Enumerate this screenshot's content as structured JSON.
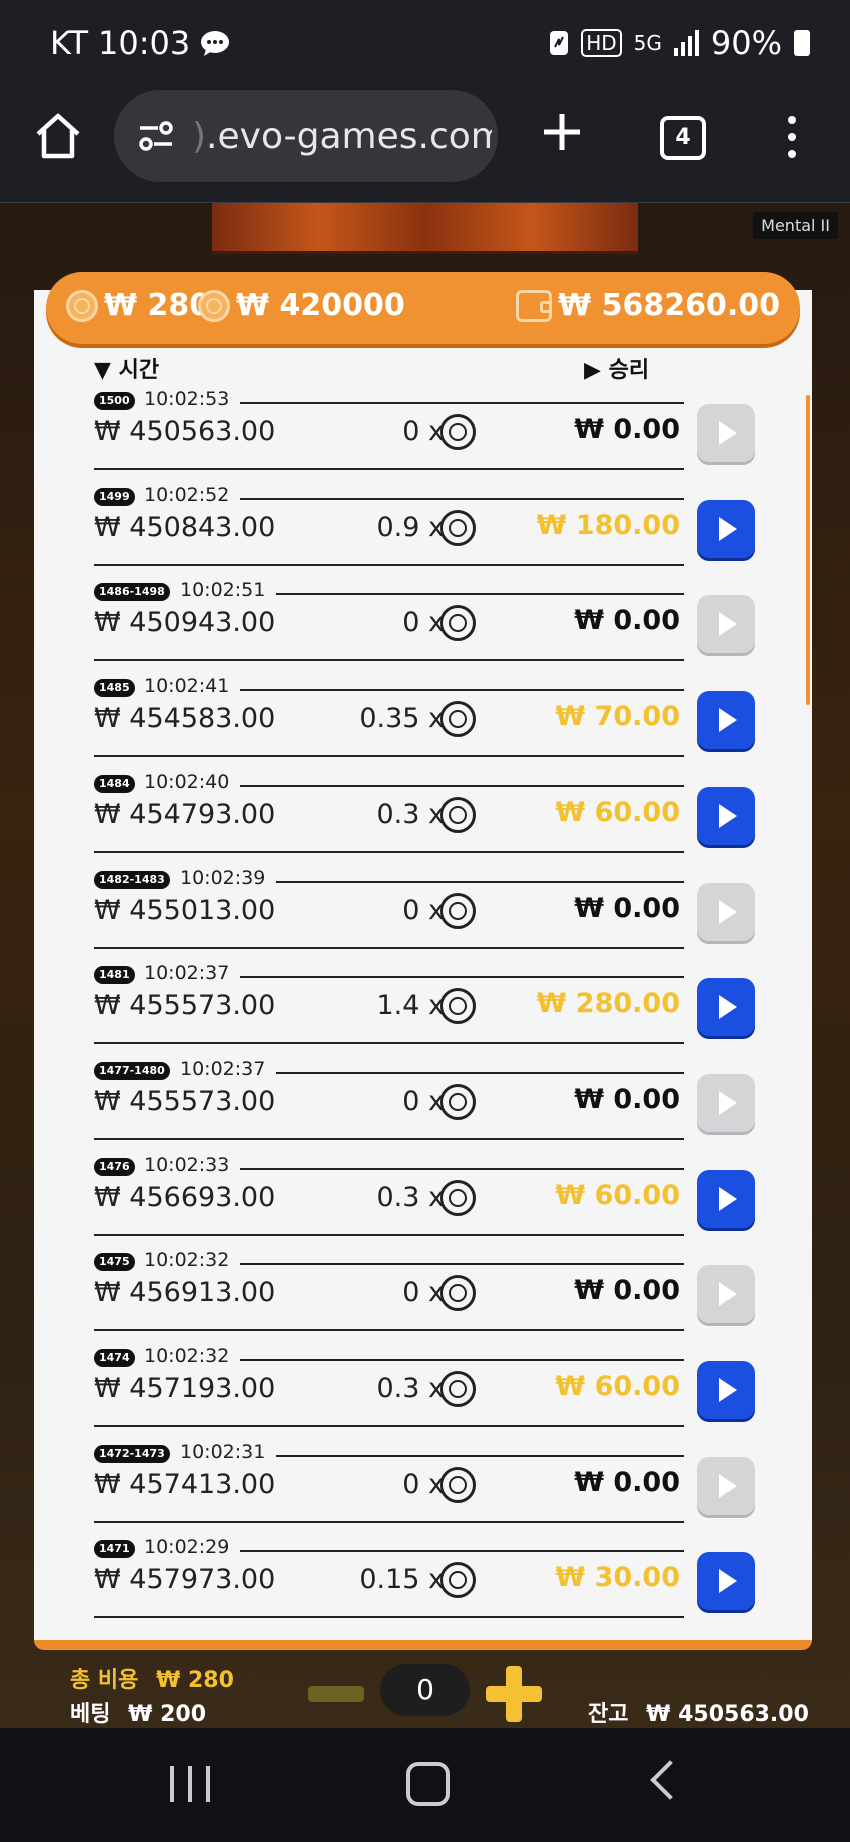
{
  "status": {
    "carrier": "KT",
    "time": "10:03",
    "hd": "HD",
    "network": "5G",
    "battery": "90%"
  },
  "browser": {
    "url_fade": ")",
    "url": ".evo-games.com",
    "tab_count": "4"
  },
  "overlay": {
    "tag": "Mental II"
  },
  "balances": {
    "bet_cost": "₩ 280",
    "pot": "₩ 420000",
    "wallet": "₩ 568260.00"
  },
  "columns": {
    "time": "시간",
    "win": "승리"
  },
  "history": [
    {
      "id": "1500",
      "time": "10:02:53",
      "bet": "₩ 450563.00",
      "multiplier": "0 x",
      "win": "₩ 0.00",
      "won": false
    },
    {
      "id": "1499",
      "time": "10:02:52",
      "bet": "₩ 450843.00",
      "multiplier": "0.9 x",
      "win": "₩ 180.00",
      "won": true
    },
    {
      "id": "1486-1498",
      "time": "10:02:51",
      "bet": "₩ 450943.00",
      "multiplier": "0 x",
      "win": "₩ 0.00",
      "won": false
    },
    {
      "id": "1485",
      "time": "10:02:41",
      "bet": "₩ 454583.00",
      "multiplier": "0.35 x",
      "win": "₩ 70.00",
      "won": true
    },
    {
      "id": "1484",
      "time": "10:02:40",
      "bet": "₩ 454793.00",
      "multiplier": "0.3 x",
      "win": "₩ 60.00",
      "won": true
    },
    {
      "id": "1482-1483",
      "time": "10:02:39",
      "bet": "₩ 455013.00",
      "multiplier": "0 x",
      "win": "₩ 0.00",
      "won": false
    },
    {
      "id": "1481",
      "time": "10:02:37",
      "bet": "₩ 455573.00",
      "multiplier": "1.4 x",
      "win": "₩ 280.00",
      "won": true
    },
    {
      "id": "1477-1480",
      "time": "10:02:37",
      "bet": "₩ 455573.00",
      "multiplier": "0 x",
      "win": "₩ 0.00",
      "won": false
    },
    {
      "id": "1476",
      "time": "10:02:33",
      "bet": "₩ 456693.00",
      "multiplier": "0.3 x",
      "win": "₩ 60.00",
      "won": true
    },
    {
      "id": "1475",
      "time": "10:02:32",
      "bet": "₩ 456913.00",
      "multiplier": "0 x",
      "win": "₩ 0.00",
      "won": false
    },
    {
      "id": "1474",
      "time": "10:02:32",
      "bet": "₩ 457193.00",
      "multiplier": "0.3 x",
      "win": "₩ 60.00",
      "won": true
    },
    {
      "id": "1472-1473",
      "time": "10:02:31",
      "bet": "₩ 457413.00",
      "multiplier": "0 x",
      "win": "₩ 0.00",
      "won": false
    },
    {
      "id": "1471",
      "time": "10:02:29",
      "bet": "₩ 457973.00",
      "multiplier": "0.15 x",
      "win": "₩ 30.00",
      "won": true
    }
  ],
  "footer": {
    "total_cost_label": "총 비용",
    "total_cost": "₩ 280",
    "betting_label": "베팅",
    "betting": "₩ 200",
    "count": "0",
    "balance_label": "잔고",
    "balance": "₩ 450563.00"
  },
  "colors": {
    "accent": "#f09231",
    "win": "#f3c12f",
    "play_active": "#1a4fe0",
    "play_inactive": "#d5d5d8"
  }
}
